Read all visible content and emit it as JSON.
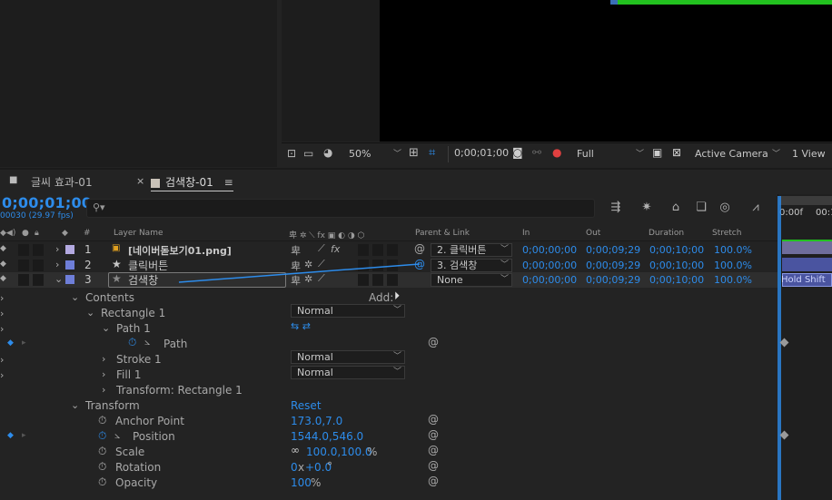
{
  "viewer": {
    "zoom": "50%",
    "timecode": "0;00;01;00",
    "resolution": "Full",
    "camera": "Active Camera",
    "views": "1 View"
  },
  "tabs": [
    {
      "label": "글씨 효과-01",
      "color": "#8d7b65"
    },
    {
      "label": "검색창-01",
      "color": "#c9c2b8"
    }
  ],
  "timeline": {
    "timecode": "0;00;01;00",
    "fps": "00030 (29.97 fps)",
    "search_placeholder": "",
    "ruler_start": "0:00f",
    "ruler_next": "00:1"
  },
  "columns": {
    "num": "#",
    "layer_name": "Layer Name",
    "parent_link": "Parent & Link",
    "in": "In",
    "out": "Out",
    "duration": "Duration",
    "stretch": "Stretch"
  },
  "layers": [
    {
      "num": "1",
      "color": "#b3a9e0",
      "name": "[네이버돋보기01.png]",
      "parent": "2. 클릭버튼",
      "in": "0;00;00;00",
      "out": "0;00;09;29",
      "duration": "0;00;10;00",
      "stretch": "100.0%"
    },
    {
      "num": "2",
      "color": "#6e7ed8",
      "name": "클릭버튼",
      "parent": "3. 검색창",
      "in": "0;00;00;00",
      "out": "0;00;09;29",
      "duration": "0;00;10;00",
      "stretch": "100.0%"
    },
    {
      "num": "3",
      "color": "#6e7ed8",
      "name": "검색창",
      "parent": "None",
      "in": "0;00;00;00",
      "out": "0;00;09;29",
      "duration": "0;00;10;00",
      "stretch": "100.0%"
    }
  ],
  "track_hint": "Hold Shift",
  "contents": {
    "label": "Contents",
    "add_label": "Add:",
    "rectangle": "Rectangle 1",
    "rect_mode": "Normal",
    "path_group": "Path 1",
    "path": "Path",
    "stroke": "Stroke 1",
    "stroke_mode": "Normal",
    "fill": "Fill 1",
    "fill_mode": "Normal",
    "transform_rect": "Transform: Rectangle 1"
  },
  "transform": {
    "label": "Transform",
    "reset": "Reset",
    "anchor_label": "Anchor Point",
    "anchor_value": "173.0,7.0",
    "position_label": "Position",
    "position_value": "1544.0,546.0",
    "scale_label": "Scale",
    "scale_value": "100.0,100.0",
    "scale_unit": "%",
    "rotation_label": "Rotation",
    "rotation_turns": "0",
    "rotation_x": "x",
    "rotation_value": "+0.0",
    "rotation_unit": "°",
    "opacity_label": "Opacity",
    "opacity_value": "100",
    "opacity_unit": "%"
  }
}
